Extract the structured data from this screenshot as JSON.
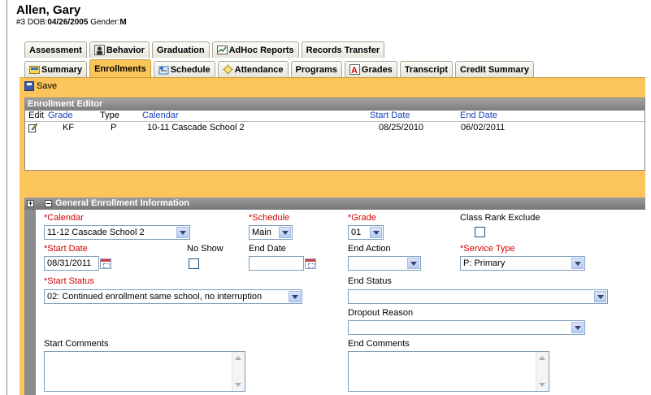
{
  "student": {
    "name": "Allen, Gary",
    "id_prefix": "#3",
    "dob_label": "DOB:",
    "dob_value": "04/26/2005",
    "gender_label": "Gender:",
    "gender_value": "M"
  },
  "tabs_row1": [
    {
      "label": "Assessment",
      "icon": "none"
    },
    {
      "label": "Behavior",
      "icon": "behavior-icon"
    },
    {
      "label": "Graduation",
      "icon": "none"
    },
    {
      "label": "AdHoc Reports",
      "icon": "adhoc-reports-icon"
    },
    {
      "label": "Records Transfer",
      "icon": "none"
    }
  ],
  "tabs_row2": [
    {
      "label": "Summary",
      "icon": "summary-icon"
    },
    {
      "label": "Enrollments",
      "icon": "none",
      "active": true
    },
    {
      "label": "Schedule",
      "icon": "schedule-icon"
    },
    {
      "label": "Attendance",
      "icon": "attendance-icon"
    },
    {
      "label": "Programs",
      "icon": "none"
    },
    {
      "label": "Grades",
      "icon": "grades-icon"
    },
    {
      "label": "Transcript",
      "icon": "none"
    },
    {
      "label": "Credit Summary",
      "icon": "none"
    }
  ],
  "toolbar": {
    "save_label": "Save"
  },
  "enrollment_editor": {
    "title": "Enrollment Editor",
    "columns": [
      "Edit",
      "Grade",
      "Type",
      "Calendar",
      "Start Date",
      "End Date"
    ],
    "rows": [
      {
        "grade": "KF",
        "type": "P",
        "calendar": "10-11 Cascade School 2",
        "start_date": "08/25/2010",
        "end_date": "06/02/2011"
      }
    ]
  },
  "general": {
    "title": "General Enrollment Information",
    "expand_symbol": "+",
    "calendar_label": "*Calendar",
    "calendar_value": "11-12 Cascade School 2",
    "schedule_label": "*Schedule",
    "schedule_value": "Main",
    "grade_label": "*Grade",
    "grade_value": "01",
    "class_rank_label": "Class Rank Exclude",
    "class_rank_checked": false,
    "start_date_label": "*Start Date",
    "start_date_value": "08/31/2011",
    "no_show_label": "No Show",
    "no_show_checked": false,
    "end_date_label": "End Date",
    "end_date_value": "",
    "end_action_label": "End Action",
    "end_action_value": "",
    "service_type_label": "*Service Type",
    "service_type_value": "P: Primary",
    "start_status_label": "*Start Status",
    "start_status_value": "02: Continued enrollment same school, no interruption",
    "end_status_label": "End Status",
    "end_status_value": "",
    "dropout_reason_label": "Dropout Reason",
    "dropout_reason_value": "",
    "start_comments_label": "Start Comments",
    "start_comments_value": "",
    "end_comments_label": "End Comments",
    "end_comments_value": ""
  },
  "colors": {
    "accent_orange": "#fbc55c",
    "header_gray": "#8c8c8c",
    "link_blue": "#1a3fbd",
    "required_red": "#d40000"
  }
}
